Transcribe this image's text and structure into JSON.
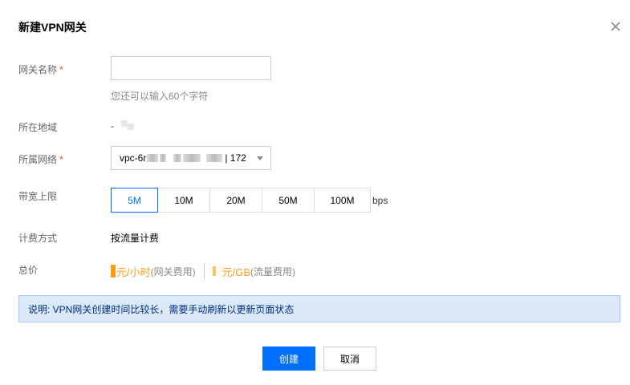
{
  "dialog": {
    "title": "新建VPN网关",
    "close_icon": "close-icon"
  },
  "form": {
    "name": {
      "label": "网关名称",
      "required_mark": "*",
      "value": "",
      "placeholder": "",
      "hint": "您还可以输入60个字符"
    },
    "region": {
      "label": "所在地域",
      "value": "-"
    },
    "network": {
      "label": "所属网络",
      "required_mark": "*",
      "prefix": "vpc-6r",
      "suffix": "| 172"
    },
    "bandwidth": {
      "label": "带宽上限",
      "options": [
        "5M",
        "10M",
        "20M",
        "50M",
        "100M"
      ],
      "selected": "5M",
      "unit": "bps"
    },
    "billing": {
      "label": "计费方式",
      "value": "按流量计费"
    },
    "price": {
      "label": "总价",
      "hourly_unit": "元/小时",
      "hourly_note": "(网关费用)",
      "traffic_unit": "元/GB",
      "traffic_note": "(流量费用)"
    }
  },
  "notice": "说明: VPN网关创建时间比较长，需要手动刷新以更新页面状态",
  "buttons": {
    "create": "创建",
    "cancel": "取消"
  },
  "colors": {
    "primary": "#006eff",
    "price": "#ff9c19",
    "required": "#e54545",
    "notice_bg": "#dbe9f8",
    "notice_border": "#a9c9ec"
  }
}
